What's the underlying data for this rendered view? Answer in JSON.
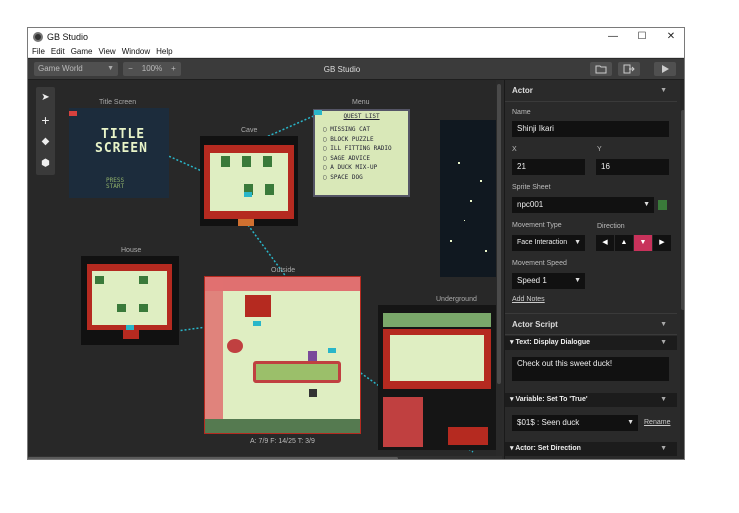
{
  "window": {
    "title": "GB Studio",
    "minimize": "—",
    "maximize": "☐",
    "close": "✕"
  },
  "menu": [
    "File",
    "Edit",
    "Game",
    "View",
    "Window",
    "Help"
  ],
  "toolbar": {
    "view_select": "Game World",
    "zoom_minus": "−",
    "zoom_value": "100%",
    "zoom_plus": "+",
    "project_title": "GB Studio",
    "folder_icon": "folder-icon",
    "export_icon": "export-icon",
    "play_icon": "play-icon"
  },
  "tools": [
    "select-tool-icon",
    "add-tool-icon",
    "eraser-tool-icon",
    "colors-tool-icon"
  ],
  "scenes": {
    "title_screen": "Title Screen",
    "menu": "Menu",
    "cave": "Cave",
    "house": "House",
    "outside": "Outside",
    "underground": "Underground",
    "title_text_1": "TITLE",
    "title_text_2": "SCREEN",
    "press_start_1": "PRESS",
    "press_start_2": "START"
  },
  "quest_list": {
    "heading": "QUEST LIST",
    "items": [
      "MISSING CAT",
      "BLOCK PUZZLE",
      "ILL FITTING RADIO",
      "SAGE ADVICE",
      "A DUCK MIX-UP",
      "SPACE DOG"
    ]
  },
  "status": "A: 7/9   F: 14/25   T: 3/9",
  "sidebar": {
    "header": "Actor",
    "name_label": "Name",
    "name_value": "Shinji Ikari",
    "x_label": "X",
    "x_value": "21",
    "y_label": "Y",
    "y_value": "16",
    "sprite_label": "Sprite Sheet",
    "sprite_value": "npc001",
    "movement_type_label": "Movement Type",
    "movement_type_value": "Face Interaction",
    "direction_label": "Direction",
    "directions": [
      "◀",
      "▲",
      "▼",
      "▶"
    ],
    "movement_speed_label": "Movement Speed",
    "movement_speed_value": "Speed 1",
    "add_notes": "Add Notes",
    "script_header": "Actor Script",
    "event1_title": "▾ Text: Display Dialogue",
    "event1_text": "Check out this sweet duck!",
    "event2_title": "▾ Variable: Set To 'True'",
    "event2_value": "$01$ : Seen duck",
    "rename": "Rename",
    "event3_title": "▾ Actor: Set Direction"
  },
  "colors": {
    "accent_active": "#c8325b",
    "trigger": "#29b6c9",
    "start_flag": "#d6413e",
    "scene_bg_green": "#e8f4c8",
    "scene_wall_red": "#b52a20"
  }
}
